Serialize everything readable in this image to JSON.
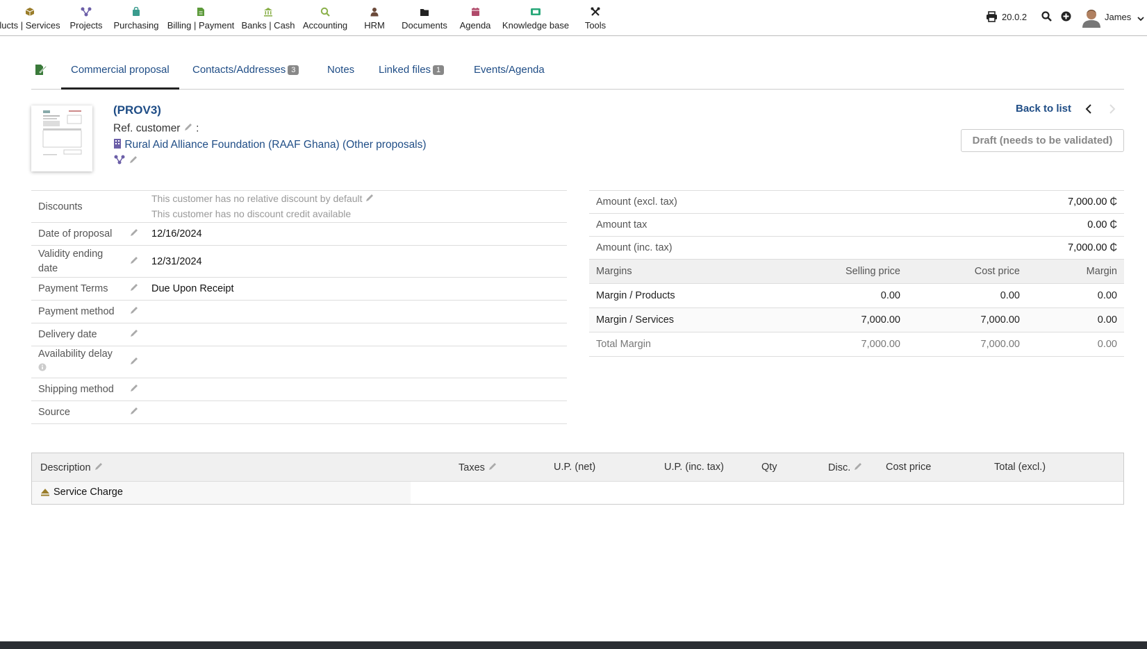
{
  "nav": {
    "items": [
      {
        "label": "lucts | Services",
        "icon": "box-icon",
        "color": "#9a7d2a"
      },
      {
        "label": "Projects",
        "icon": "projects-icon",
        "color": "#6c5fa8"
      },
      {
        "label": "Purchasing",
        "icon": "purchasing-icon",
        "color": "#3a9c8e"
      },
      {
        "label": "Billing | Payment",
        "icon": "billing-icon",
        "color": "#5c9a3a"
      },
      {
        "label": "Banks | Cash",
        "icon": "bank-icon",
        "color": "#8ab04a"
      },
      {
        "label": "Accounting",
        "icon": "accounting-icon",
        "color": "#8ab04a"
      },
      {
        "label": "HRM",
        "icon": "hrm-icon",
        "color": "#6b4a3a"
      },
      {
        "label": "Documents",
        "icon": "documents-icon",
        "color": "#222222"
      },
      {
        "label": "Agenda",
        "icon": "agenda-icon",
        "color": "#b04a6a"
      },
      {
        "label": "Knowledge base",
        "icon": "knowledge-icon",
        "color": "#2aa87a"
      },
      {
        "label": "Tools",
        "icon": "tools-icon",
        "color": "#222222"
      }
    ],
    "version": "20.0.2",
    "user": "James"
  },
  "tabs": [
    {
      "label": "Commercial proposal"
    },
    {
      "label": "Contacts/Addresses",
      "badge": "3"
    },
    {
      "label": "Notes"
    },
    {
      "label": "Linked files",
      "badge": "1"
    },
    {
      "label": "Events/Agenda"
    }
  ],
  "header": {
    "ref": "(PROV3)",
    "ref_customer_label": "Ref. customer",
    "ref_customer_sep": ":",
    "company": "Rural Aid Alliance Foundation (RAAF Ghana)",
    "other_proposals": "(Other proposals)",
    "back_to_list": "Back to list",
    "status": "Draft (needs to be validated)"
  },
  "fields": {
    "discounts_label": "Discounts",
    "discount_line1": "This customer has no relative discount by default",
    "discount_line2": "This customer has no discount credit available",
    "date_label": "Date of proposal",
    "date_value": "12/16/2024",
    "validity_label": "Validity ending date",
    "validity_value": "12/31/2024",
    "payment_terms_label": "Payment Terms",
    "payment_terms_value": "Due Upon Receipt",
    "payment_method_label": "Payment method",
    "delivery_label": "Delivery date",
    "availability_label": "Availability delay",
    "shipping_label": "Shipping method",
    "source_label": "Source"
  },
  "amounts": {
    "excl_label": "Amount (excl. tax)",
    "excl_value": "7,000.00 ₵",
    "tax_label": "Amount tax",
    "tax_value": "0.00 ₵",
    "inc_label": "Amount (inc. tax)",
    "inc_value": "7,000.00 ₵"
  },
  "margins": {
    "headers": [
      "Margins",
      "Selling price",
      "Cost price",
      "Margin"
    ],
    "rows": [
      {
        "label": "Margin / Products",
        "selling": "0.00",
        "cost": "0.00",
        "margin": "0.00"
      },
      {
        "label": "Margin / Services",
        "selling": "7,000.00",
        "cost": "7,000.00",
        "margin": "0.00"
      },
      {
        "label": "Total Margin",
        "selling": "7,000.00",
        "cost": "7,000.00",
        "margin": "0.00"
      }
    ]
  },
  "lines": {
    "headers": {
      "description": "Description",
      "taxes": "Taxes",
      "up_net": "U.P. (net)",
      "up_inc": "U.P. (inc. tax)",
      "qty": "Qty",
      "disc": "Disc.",
      "cost": "Cost price",
      "total": "Total (excl.)"
    },
    "title_line": "Service Charge"
  }
}
